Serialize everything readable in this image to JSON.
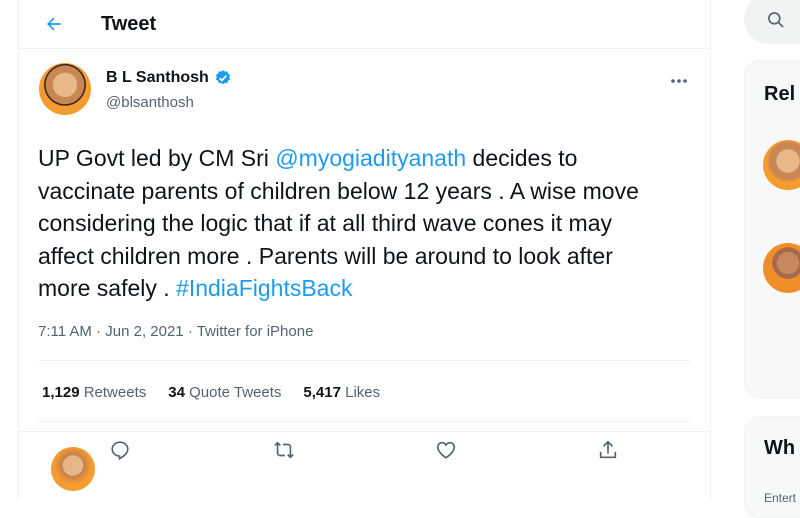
{
  "header": {
    "title": "Tweet"
  },
  "tweet": {
    "author_name": "B L Santhosh",
    "author_handle": "@blsanthosh",
    "body": [
      "UP Govt led by CM Sri ",
      "@myogiadityanath",
      " decides to vaccinate parents of children below 12 years . A wise move considering the logic that if at all third wave cones it may affect children more . Parents will be around to look after more safely . ",
      "#IndiaFightsBack"
    ],
    "meta": "7:11 AM · Jun 2, 2021 · Twitter for iPhone",
    "stats": {
      "retweets_count": "1,129",
      "retweets_label": "Retweets",
      "quotes_count": "34",
      "quotes_label": "Quote Tweets",
      "likes_count": "5,417",
      "likes_label": "Likes"
    }
  },
  "sidebar": {
    "relevant_title": "Rel",
    "whats_happening_title": "Wh",
    "whats_happening_sub": "Entert"
  },
  "colors": {
    "accent": "#1d9bf0",
    "text": "#0f1419",
    "muted": "#536471",
    "border": "#eff3f4"
  },
  "icons": [
    "back-arrow-icon",
    "verified-badge-icon",
    "more-icon",
    "reply-icon",
    "retweet-icon",
    "like-icon",
    "share-icon",
    "search-icon"
  ]
}
